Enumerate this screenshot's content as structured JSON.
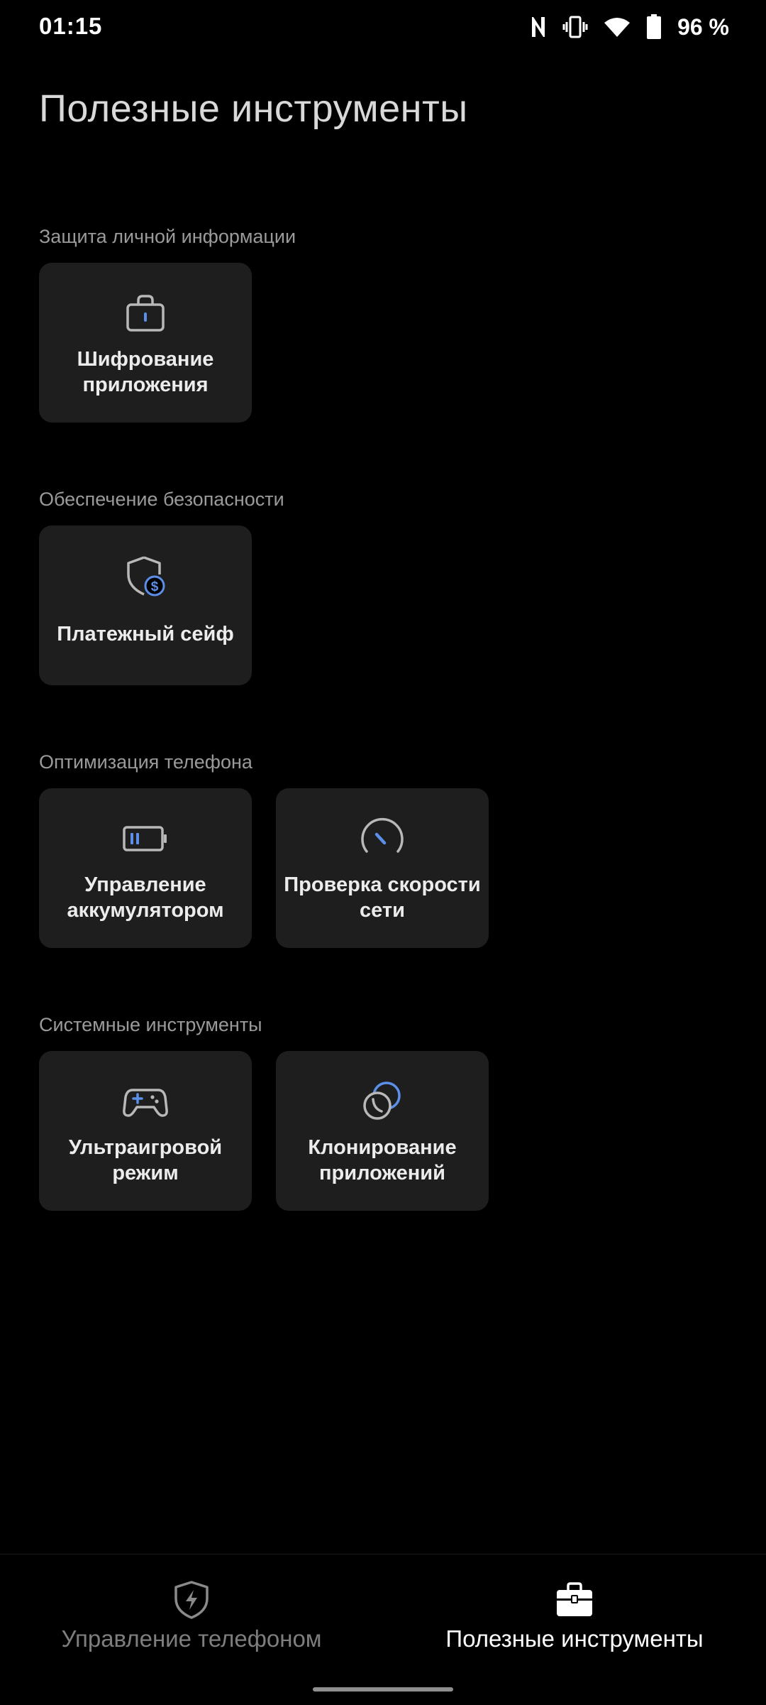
{
  "status_bar": {
    "time": "01:15",
    "battery_percent": "96 %",
    "icons": [
      "nfc-icon",
      "vibrate-icon",
      "wifi-icon",
      "battery-icon"
    ]
  },
  "page": {
    "title": "Полезные инструменты"
  },
  "sections": [
    {
      "label": "Защита личной информации",
      "tiles": [
        {
          "label": "Шифрование приложения",
          "icon": "lock-bag-icon"
        }
      ]
    },
    {
      "label": "Обеспечение безопасности",
      "tiles": [
        {
          "label": "Платежный сейф",
          "icon": "shield-dollar-icon"
        }
      ]
    },
    {
      "label": "Оптимизация телефона",
      "tiles": [
        {
          "label": "Управление аккумулятором",
          "icon": "battery-tile-icon"
        },
        {
          "label": "Проверка скорости сети",
          "icon": "speedometer-icon"
        }
      ]
    },
    {
      "label": "Системные инструменты",
      "tiles": [
        {
          "label": "Ультраигровой режим",
          "icon": "gamepad-icon"
        },
        {
          "label": "Клонирование приложений",
          "icon": "clone-icon"
        }
      ]
    }
  ],
  "bottom_nav": {
    "items": [
      {
        "label": "Управление телефоном",
        "icon": "shield-bolt-icon",
        "active": false
      },
      {
        "label": "Полезные инструменты",
        "icon": "toolbox-icon",
        "active": true
      }
    ]
  },
  "colors": {
    "accent": "#5b8fe8",
    "tile_background": "#1e1e1e",
    "background": "#000000"
  }
}
